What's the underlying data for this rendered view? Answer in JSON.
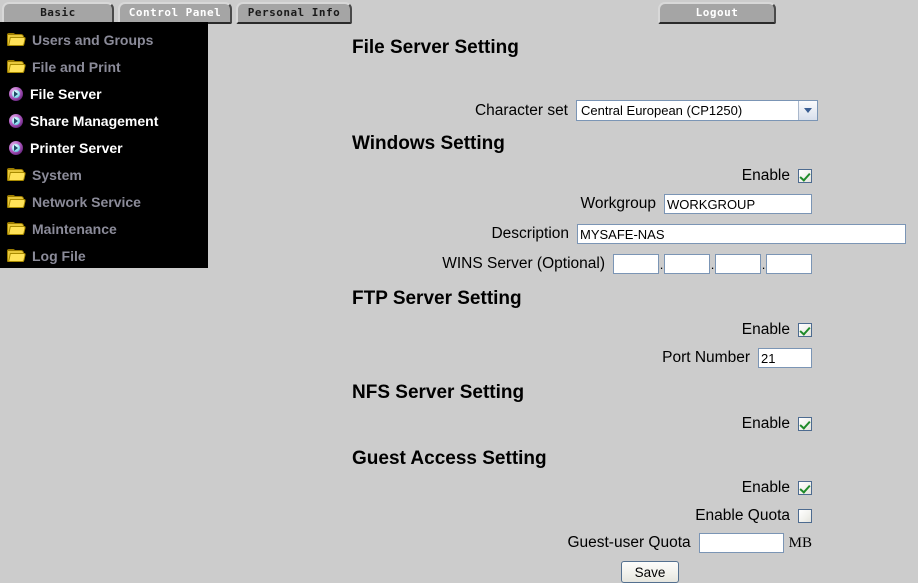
{
  "tabs": [
    {
      "label": "Basic",
      "active": false
    },
    {
      "label": "Control Panel",
      "active": true
    },
    {
      "label": "Personal Info",
      "active": false
    }
  ],
  "logout": {
    "label": "Logout"
  },
  "sidebar": {
    "items": [
      {
        "label": "Users and Groups",
        "icon": "folder-icon"
      },
      {
        "label": "File and Print",
        "icon": "folder-icon"
      },
      {
        "label": "File Server",
        "icon": "disc-icon"
      },
      {
        "label": "Share Management",
        "icon": "disc-icon"
      },
      {
        "label": "Printer Server",
        "icon": "disc-icon"
      },
      {
        "label": "System",
        "icon": "folder-icon"
      },
      {
        "label": "Network Service",
        "icon": "folder-icon"
      },
      {
        "label": "Maintenance",
        "icon": "folder-icon"
      },
      {
        "label": "Log File",
        "icon": "folder-icon"
      }
    ]
  },
  "main": {
    "page_title": "File Server Setting",
    "character_set": {
      "label": "Character set",
      "selected": "Central European (CP1250)"
    },
    "windows": {
      "heading": "Windows Setting",
      "enable_label": "Enable",
      "enable_checked": true,
      "workgroup_label": "Workgroup",
      "workgroup_value": "WORKGROUP",
      "description_label": "Description",
      "description_value": "MYSAFE-NAS",
      "wins_label": "WINS Server (Optional)",
      "wins_octets": [
        "",
        "",
        "",
        ""
      ],
      "wins_separator": "."
    },
    "ftp": {
      "heading": "FTP Server Setting",
      "enable_label": "Enable",
      "enable_checked": true,
      "port_label": "Port Number",
      "port_value": "21"
    },
    "nfs": {
      "heading": "NFS Server Setting",
      "enable_label": "Enable",
      "enable_checked": true
    },
    "guest": {
      "heading": "Guest Access Setting",
      "enable_label": "Enable",
      "enable_checked": true,
      "quota_enable_label": "Enable Quota",
      "quota_enable_checked": false,
      "quota_label": "Guest-user Quota",
      "quota_value": "",
      "quota_unit": "MB"
    },
    "save_label": "Save"
  },
  "colors": {
    "page_bg": "#cccccc",
    "sidebar_bg": "#000000",
    "nav_inactive_text": "#8b8b99",
    "nav_active_text": "#ffffff",
    "input_border": "#7b95b5",
    "check_green": "#1f8b2a"
  }
}
